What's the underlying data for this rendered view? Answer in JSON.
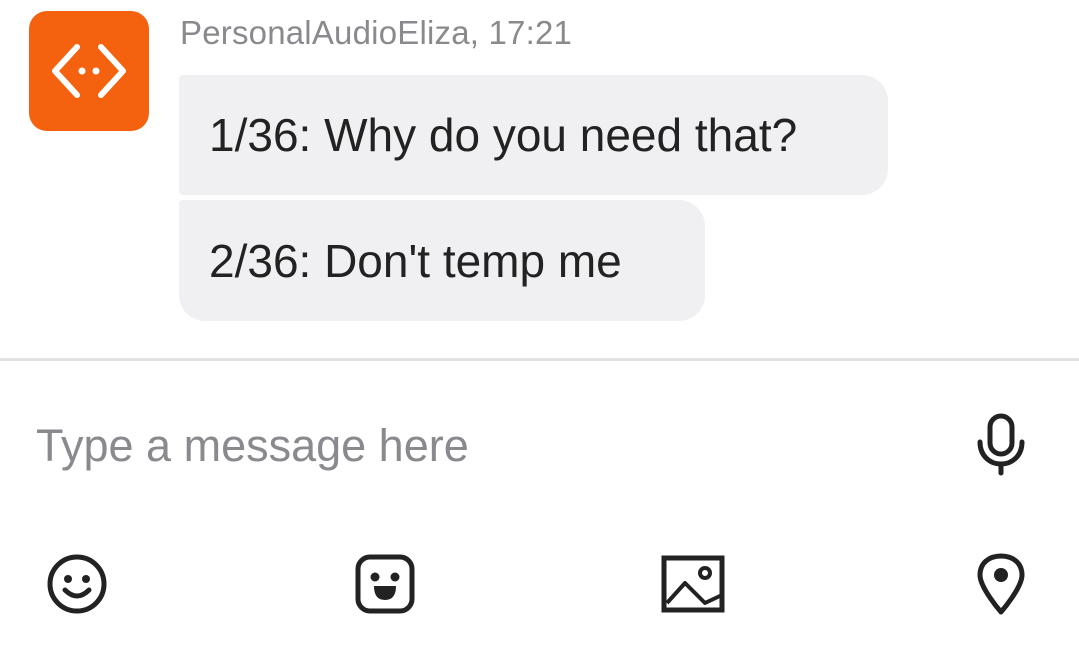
{
  "conversation": {
    "sender": "PersonalAudioEliza",
    "time": "17:21",
    "header_text": "PersonalAudioEliza, 17:21",
    "avatar_icon": "code-brackets-icon",
    "avatar_color": "#f5620f",
    "messages": [
      {
        "text": "1/36: Why do you need that?"
      },
      {
        "text": "2/36: Don't temp me"
      }
    ]
  },
  "composer": {
    "placeholder": "Type a message here",
    "value": "",
    "mic_icon": "microphone-icon"
  },
  "toolbar": {
    "icons": [
      "smiley-emoji-icon",
      "sticker-face-icon",
      "image-icon",
      "location-pin-icon"
    ]
  },
  "colors": {
    "bubble_background": "#f0f0f2",
    "secondary_text": "#8a8a8e",
    "icon_color": "#222222"
  }
}
